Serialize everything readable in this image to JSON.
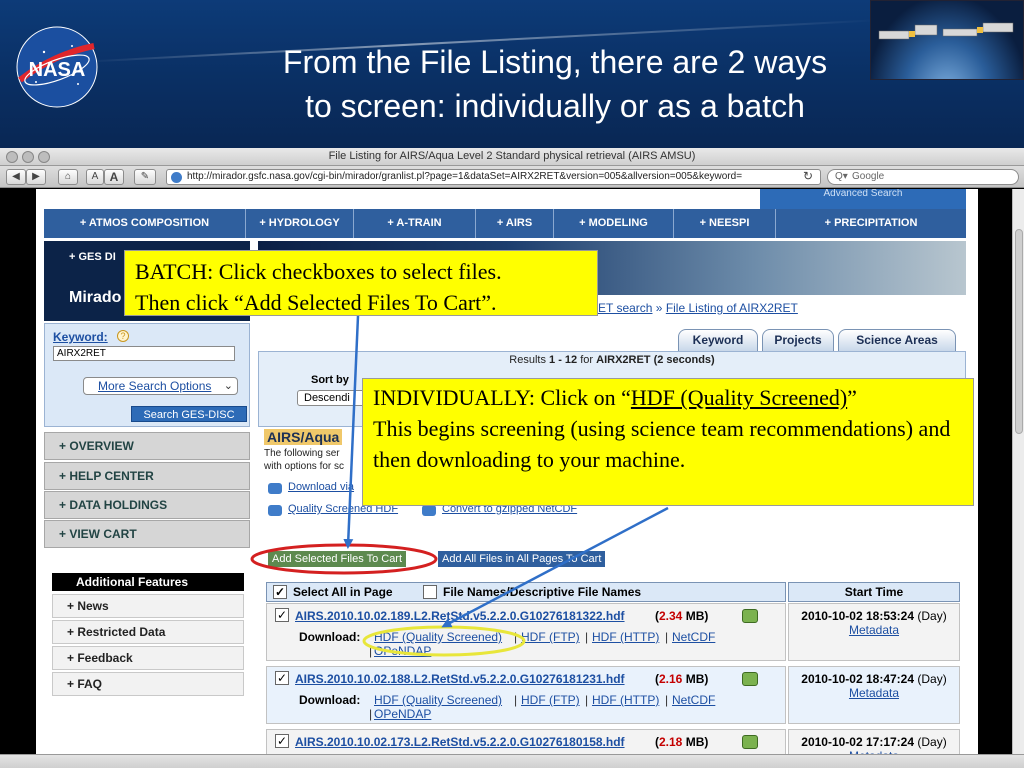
{
  "slide": {
    "title_line1": "From the File Listing, there are 2 ways",
    "title_line2": "to screen:  individually or as a batch",
    "logo_text": "NASA"
  },
  "browser": {
    "window_title": "File Listing for AIRS/Aqua Level 2 Standard physical retrieval (AIRS AMSU)",
    "url": "http://mirador.gsfc.nasa.gov/cgi-bin/mirador/granlist.pl?page=1&dataSet=AIRX2RET&version=005&allversion=005&keyword=",
    "search_placeholder": "Google",
    "font_small": "A",
    "font_large": "A",
    "add_tab": "+"
  },
  "nav": {
    "items": [
      "+ ATMOS COMPOSITION",
      "+ HYDROLOGY",
      "+ A-TRAIN",
      "+ AIRS",
      "+ MODELING",
      "+ NEESPI",
      "+ PRECIPITATION"
    ],
    "advanced_search": "Advanced Search"
  },
  "sidebar": {
    "ges_disc": "+ GES DI",
    "mirador": "Mirado",
    "keyword_label": "Keyword:",
    "help": "?",
    "keyword_value": "AIRX2RET",
    "more_options": "More Search Options",
    "search_button": "Search GES-DISC",
    "sections": [
      "+  OVERVIEW",
      "+  HELP CENTER",
      "+  DATA HOLDINGS",
      "+  VIEW CART"
    ],
    "additional_features": "Additional Features",
    "features": [
      "+  News",
      "+  Restricted Data",
      "+  Feedback",
      "+  FAQ"
    ]
  },
  "content": {
    "breadcrumb_part": "ET search",
    "breadcrumb_sep": " » ",
    "breadcrumb_current": "File Listing of AIRX2RET",
    "tabs": [
      "Keyword",
      "Projects",
      "Science Areas"
    ],
    "results_prefix": "Results ",
    "results_range": "1 - 12",
    "results_for": " for ",
    "results_keyword": "AIRX2RET (2 seconds)",
    "sort_label": "Sort by",
    "sort_value": "Descendi",
    "product_title": "AIRS/Aqua",
    "product_desc_1": "The following ser",
    "product_desc_2": "with options for sc",
    "download_via": "Download via",
    "quality_screened_hdf": "Quality Screened HDF",
    "convert_netcdf": "Convert to gzipped NetCDF",
    "add_selected": "Add Selected Files To Cart",
    "add_all": "Add All Files in All Pages To Cart",
    "select_all": "Select All in Page",
    "file_names_toggle": "File Names/Descriptive File Names",
    "start_time_header": "Start Time",
    "download_label": "Download:",
    "link_hdf_qs": "HDF (Quality Screened)",
    "link_hdf_ftp": "HDF (FTP)",
    "link_hdf_http": "HDF (HTTP)",
    "link_netcdf": "NetCDF",
    "link_opendap": "OPeNDAP",
    "metadata": "Metadata",
    "files": [
      {
        "name": "AIRS.2010.10.02.189.L2.RetStd.v5.2.2.0.G10276181322.hdf",
        "size": "2.34",
        "unit": "MB",
        "time": "2010-10-02 18:53:24",
        "daynight": "(Day)"
      },
      {
        "name": "AIRS.2010.10.02.188.L2.RetStd.v5.2.2.0.G10276181231.hdf",
        "size": "2.16",
        "unit": "MB",
        "time": "2010-10-02 18:47:24",
        "daynight": "(Day)"
      },
      {
        "name": "AIRS.2010.10.02.173.L2.RetStd.v5.2.2.0.G10276180158.hdf",
        "size": "2.18",
        "unit": "MB",
        "time": "2010-10-02 17:17:24",
        "daynight": "(Day)"
      }
    ]
  },
  "annotations": {
    "batch_line1": "BATCH:  Click checkboxes to select files.",
    "batch_line2": "Then click “Add Selected Files To Cart”.",
    "indiv_prefix": "INDIVIDUALLY:  Click on “",
    "indiv_link": "HDF (Quality Screened)",
    "indiv_suffix": "”",
    "indiv_rest": "This begins screening (using science team recommendations) and then downloading to your machine.",
    "arrow_color": "#2f6fc8",
    "highlight_red": "#d42020",
    "highlight_yellow": "#e8e63a"
  }
}
